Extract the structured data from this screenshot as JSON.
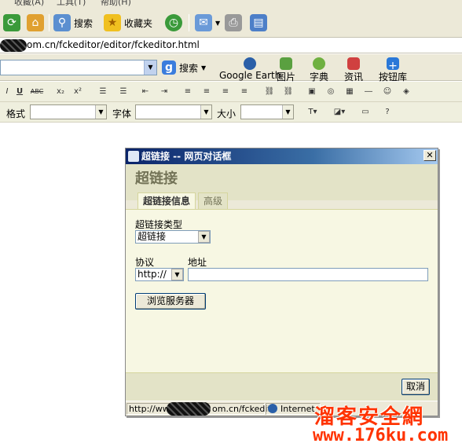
{
  "menubar": {
    "items": [
      "收藏(A)",
      "工具(T)",
      "帮助(H)"
    ]
  },
  "ie_toolbar": {
    "search_label": "搜索",
    "favorites_label": "收藏夹"
  },
  "addressbar": {
    "url": "om.cn/fckeditor/editor/fckeditor.html"
  },
  "googlebar": {
    "search_label": "搜索",
    "buttons": [
      {
        "label": "Google Earth"
      },
      {
        "label": "图片"
      },
      {
        "label": "字典"
      },
      {
        "label": "资讯"
      },
      {
        "label": "按钮库"
      }
    ]
  },
  "fck_toolbar": {
    "format_label": "格式",
    "font_label": "字体",
    "size_label": "大小",
    "buttons_row1": [
      "U",
      "ABC",
      "x₂",
      "x²"
    ]
  },
  "dialog": {
    "title": "超链接 -- 网页对话框",
    "heading": "超链接",
    "tabs": [
      {
        "label": "超链接信息"
      },
      {
        "label": "高级"
      }
    ],
    "link_type_label": "超链接类型",
    "link_type_value": "超链接",
    "protocol_label": "协议",
    "protocol_value": "http://",
    "address_label": "地址",
    "address_value": "",
    "browse_button": "浏览服务器",
    "cancel_button": "取消",
    "status_url": "http://www",
    "status_url_tail": "om.cn/fckedit",
    "status_zone": "Internet"
  },
  "watermark": {
    "line1": "溜客安全網",
    "line2": "www.176ku.com"
  },
  "colors": {
    "title_start": "#0a246a",
    "dialog_bg": "#f7f7e3",
    "watermark": "#ff3300"
  }
}
